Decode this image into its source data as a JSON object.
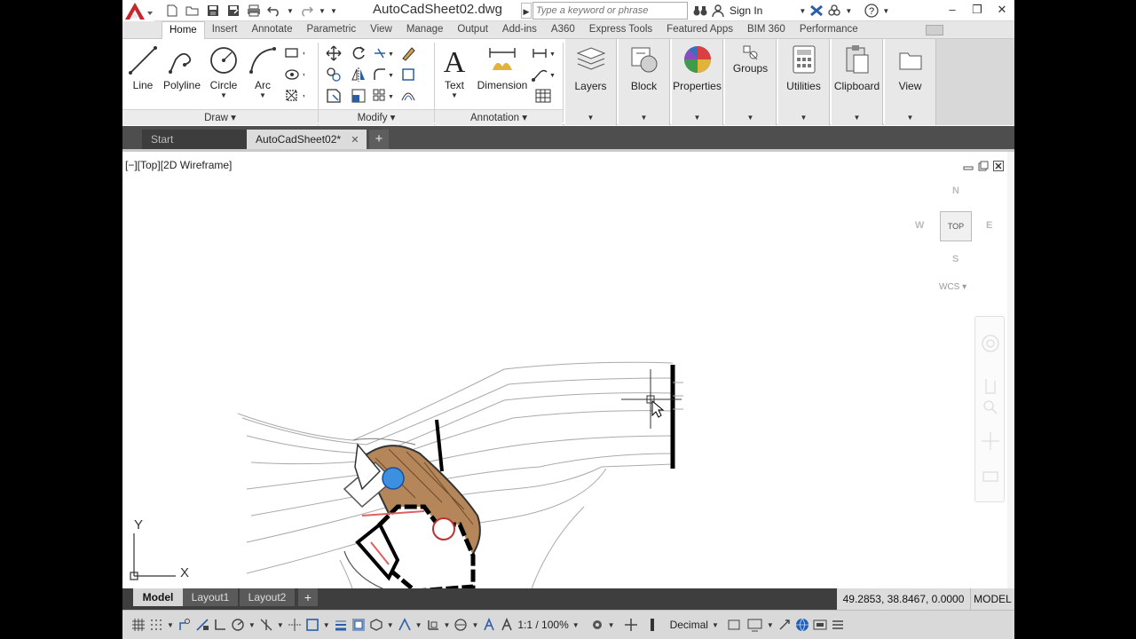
{
  "app": {
    "doc_title": "AutoCadSheet02.dwg",
    "search_placeholder": "Type a keyword or phrase",
    "sign_in": "Sign In",
    "accent": "#c8262c"
  },
  "ribbon": {
    "tabs": [
      "Home",
      "Insert",
      "Annotate",
      "Parametric",
      "View",
      "Manage",
      "Output",
      "Add-ins",
      "A360",
      "Express Tools",
      "Featured Apps",
      "BIM 360",
      "Performance"
    ],
    "active_tab": "Home",
    "draw": {
      "line": "Line",
      "polyline": "Polyline",
      "circle": "Circle",
      "arc": "Arc",
      "panel": "Draw"
    },
    "modify": {
      "panel": "Modify"
    },
    "annotation": {
      "text": "Text",
      "dimension": "Dimension",
      "panel": "Annotation"
    },
    "groups": {
      "layers": "Layers",
      "block": "Block",
      "properties": "Properties",
      "groups": "Groups",
      "utilities": "Utilities",
      "clipboard": "Clipboard",
      "view": "View"
    }
  },
  "file_tabs": {
    "start": "Start",
    "doc": "AutoCadSheet02*"
  },
  "viewport": {
    "label": "[−][Top][2D Wireframe]",
    "viewcube": {
      "n": "N",
      "s": "S",
      "e": "E",
      "w": "W",
      "top": "TOP",
      "wcs": "WCS"
    },
    "ucs": {
      "x": "X",
      "y": "Y"
    }
  },
  "layout_tabs": {
    "model": "Model",
    "layout1": "Layout1",
    "layout2": "Layout2"
  },
  "coords": "49.2853, 38.8467, 0.0000",
  "space": "MODEL",
  "status": {
    "scale": "1:1 / 100%",
    "units": "Decimal"
  }
}
